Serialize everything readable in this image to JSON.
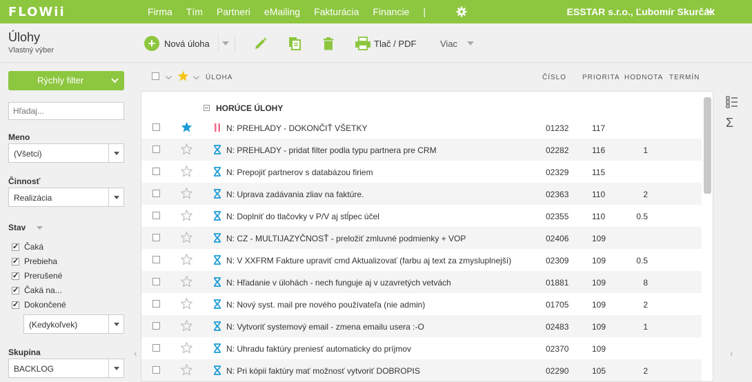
{
  "app": {
    "logo": "FLOWii"
  },
  "nav": {
    "items": [
      "Firma",
      "Tím",
      "Partneri",
      "eMailing",
      "Fakturácia",
      "Financie"
    ],
    "separator": "|",
    "user": "ESSTAR s.r.o., Ľubomír Skurčák"
  },
  "page": {
    "title": "Úlohy",
    "subtitle": "Vlastný výber"
  },
  "toolbar": {
    "new_label": "Nová úloha",
    "print_label": "Tlač / PDF",
    "more_label": "Viac"
  },
  "sidebar": {
    "quick_filter_label": "Rýchly filter",
    "search_placeholder": "Hľadaj...",
    "meno_label": "Meno",
    "meno_value": "(Všetci)",
    "cinnost_label": "Činnosť",
    "cinnost_value": "Realizácia",
    "stav_label": "Stav",
    "stav_items": [
      {
        "label": "Čaká",
        "checked": true
      },
      {
        "label": "Prebieha",
        "checked": true
      },
      {
        "label": "Prerušené",
        "checked": true
      },
      {
        "label": "Čaká na...",
        "checked": true
      },
      {
        "label": "Dokončené",
        "checked": true
      }
    ],
    "kedykolvek_value": "(Kedykoľvek)",
    "skupina_label": "Skupina",
    "skupina_value": "BACKLOG"
  },
  "table": {
    "columns": {
      "task": "ÚLOHA",
      "number": "ČÍSLO",
      "priority": "PRIORITA",
      "value": "HODNOTA",
      "deadline": "TERMÍN"
    },
    "group_label": "HORÚCE ÚLOHY",
    "rows": [
      {
        "name": "N: PREHLADY - DOKONČIŤ VŠETKY",
        "number": "01232",
        "priority": "117",
        "value": "",
        "starred": true,
        "status": "paused"
      },
      {
        "name": "N: PREHLADY - pridat filter podla typu partnera pre CRM",
        "number": "02282",
        "priority": "116",
        "value": "1",
        "starred": false,
        "status": "waiting"
      },
      {
        "name": "N: Prepojiť partnerov s databázou firiem",
        "number": "02329",
        "priority": "115",
        "value": "",
        "starred": false,
        "status": "waiting"
      },
      {
        "name": "N: Uprava zadávania zliav na faktúre.",
        "number": "02363",
        "priority": "110",
        "value": "2",
        "starred": false,
        "status": "waiting"
      },
      {
        "name": "N: Doplniť do tlačovky v P/V aj stĺpec účel",
        "number": "02355",
        "priority": "110",
        "value": "0.5",
        "starred": false,
        "status": "waiting"
      },
      {
        "name": "N: CZ - MULTIJAZYČNOSŤ - preložiť zmluvné podmienky + VOP",
        "number": "02406",
        "priority": "109",
        "value": "",
        "starred": false,
        "status": "waiting"
      },
      {
        "name": "N: V XXFRM Fakture upraviť cmd Aktualizovať (farbu aj text za zmysluplnejší)",
        "number": "02309",
        "priority": "109",
        "value": "0.5",
        "starred": false,
        "status": "waiting"
      },
      {
        "name": "N: Hľadanie v úlohách - nech funguje aj v uzavretých vetvách",
        "number": "01881",
        "priority": "109",
        "value": "8",
        "starred": false,
        "status": "waiting"
      },
      {
        "name": "N: Nový syst. mail pre nového používateľa (nie admin)",
        "number": "01705",
        "priority": "109",
        "value": "2",
        "starred": false,
        "status": "waiting"
      },
      {
        "name": "N: Vytvoriť systemový email - zmena emailu usera :-O",
        "number": "02483",
        "priority": "109",
        "value": "1",
        "starred": false,
        "status": "waiting"
      },
      {
        "name": "N: Uhradu faktúry preniesť automaticky do príjmov",
        "number": "02370",
        "priority": "109",
        "value": "",
        "starred": false,
        "status": "waiting"
      },
      {
        "name": "N: Pri kópii faktúry mať možnosť vytvoriť DOBROPIS",
        "number": "02290",
        "priority": "105",
        "value": "2",
        "starred": false,
        "status": "waiting"
      }
    ]
  },
  "colors": {
    "brand": "#8dc63f",
    "status_waiting": "#1a9bd7",
    "status_paused": "#f06d8a",
    "star_active": "#1a9bd7",
    "star_header": "#f5c518"
  },
  "icons": [
    "gear-icon",
    "plus-icon",
    "pencil-icon",
    "copy-icon",
    "trash-icon",
    "printer-icon",
    "star-icon",
    "hourglass-icon",
    "pause-icon",
    "list-icon",
    "sigma-icon"
  ]
}
